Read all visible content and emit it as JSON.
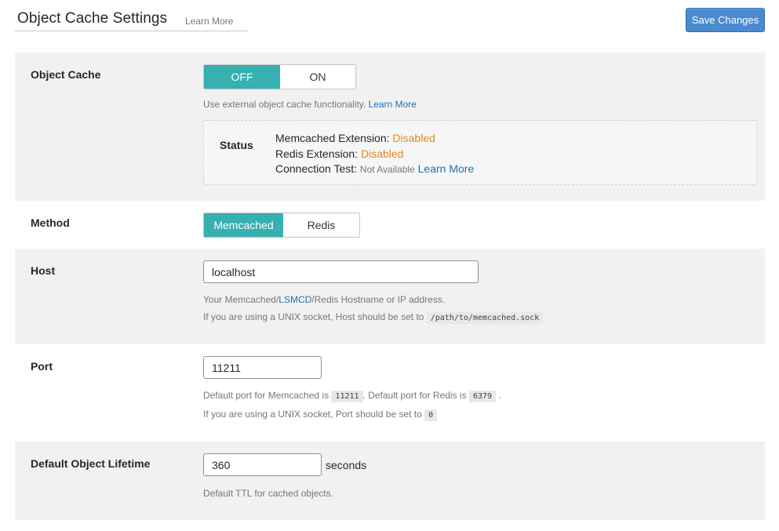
{
  "header": {
    "title": "Object Cache Settings",
    "learn_more": "Learn More",
    "save_label": "Save Changes"
  },
  "object_cache": {
    "label": "Object Cache",
    "off_label": "OFF",
    "on_label": "ON",
    "selected": "OFF",
    "desc_text": "Use external object cache functionality.",
    "desc_link": "Learn More",
    "status": {
      "label": "Status",
      "memcached_label": "Memcached Extension:",
      "memcached_value": "Disabled",
      "redis_label": "Redis Extension:",
      "redis_value": "Disabled",
      "connection_label": "Connection Test:",
      "connection_value": "Not Available",
      "connection_link": "Learn More"
    }
  },
  "method": {
    "label": "Method",
    "options": [
      "Memcached",
      "Redis"
    ],
    "selected": "Memcached"
  },
  "host": {
    "label": "Host",
    "value": "localhost",
    "desc_prefix": "Your Memcached/",
    "desc_lsmcd": "LSMCD",
    "desc_suffix": "/Redis Hostname or IP address.",
    "desc_line2": "If you are using a UNIX socket, Host should be set to",
    "socket_path": "/path/to/memcached.sock"
  },
  "port": {
    "label": "Port",
    "value": "11211",
    "desc_a": "Default port for Memcached is",
    "memcached_port": "11211",
    "desc_b": ". Default port for Redis is",
    "redis_port": "6379",
    "desc_c": ".",
    "desc_line2": "If you are using a UNIX socket, Port should be set to",
    "socket_port": "0"
  },
  "lifetime": {
    "label": "Default Object Lifetime",
    "value": "360",
    "unit": "seconds",
    "desc": "Default TTL for cached objects."
  },
  "colors": {
    "toggle_active": "#36b0b0",
    "button": "#4a8bd0",
    "warning": "#e58a1f",
    "link": "#2271b1"
  }
}
